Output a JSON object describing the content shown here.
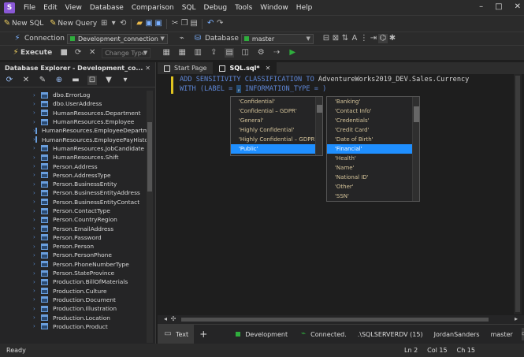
{
  "app": {
    "logo": "S",
    "window_controls": [
      "–",
      "□",
      "✕"
    ]
  },
  "menu": [
    "File",
    "Edit",
    "View",
    "Database",
    "Comparison",
    "SQL",
    "Debug",
    "Tools",
    "Window",
    "Help"
  ],
  "toolbar": {
    "new_sql": "New SQL",
    "new_query": "New Query",
    "connection_label": "Connection",
    "connection_value": "Development_connection",
    "database_label": "Database",
    "database_value": "master",
    "execute": "Execute",
    "change_type": "Change Type"
  },
  "explorer": {
    "title": "Database Explorer - Development_co...",
    "items": [
      "dbo.ErrorLog",
      "dbo.UserAddress",
      "HumanResources.Department",
      "HumanResources.Employee",
      "HumanResources.EmployeeDepartme",
      "HumanResources.EmployeePayHistor",
      "HumanResources.JobCandidate",
      "HumanResources.Shift",
      "Person.Address",
      "Person.AddressType",
      "Person.BusinessEntity",
      "Person.BusinessEntityAddress",
      "Person.BusinessEntityContact",
      "Person.ContactType",
      "Person.CountryRegion",
      "Person.EmailAddress",
      "Person.Password",
      "Person.Person",
      "Person.PersonPhone",
      "Person.PhoneNumberType",
      "Person.StateProvince",
      "Production.BillOfMaterials",
      "Production.Culture",
      "Production.Document",
      "Production.Illustration",
      "Production.Location",
      "Production.Product"
    ]
  },
  "tabs": [
    {
      "label": "Start Page"
    },
    {
      "label": "SQL.sql*",
      "close": "✕"
    }
  ],
  "code": {
    "line1": {
      "kw": "ADD SENSITIVITY CLASSIFICATION TO",
      "rest": " AdventureWorks2019_DEV.Sales.Currency"
    },
    "line2": {
      "kw1": "WITH",
      "a": " (LABEL = ",
      "cursor": ",",
      "b": " INFORMATION_TYPE = )"
    }
  },
  "label_popup": {
    "items": [
      "'Confidential'",
      "'Confidential – GDPR'",
      "'General'",
      "'Highly Confidential'",
      "'Highly Confidential – GDPR'",
      "'Public'"
    ],
    "selected_index": 5
  },
  "info_popup": {
    "items": [
      "'Banking'",
      "'Contact Info'",
      "'Credentials'",
      "'Credit Card'",
      "'Date of Birth'",
      "'Financial'",
      "'Health'",
      "'Name'",
      "'National ID'",
      "'Other'",
      "'SSN'"
    ],
    "selected_index": 5
  },
  "bottom": {
    "text_tab": "Text",
    "add": "+",
    "environment": "Development",
    "status": "Connected.",
    "server": ".\\SQLSERVERDV (15)",
    "user": "JordanSanders",
    "db": "master"
  },
  "statusbar": {
    "ready": "Ready",
    "ln": "Ln 2",
    "col": "Col 15",
    "ch": "Ch 15"
  }
}
